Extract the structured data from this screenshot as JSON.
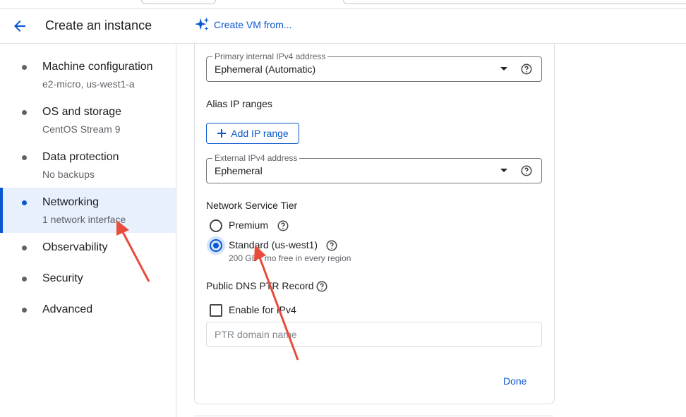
{
  "header": {
    "title": "Create an instance",
    "create_vm_label": "Create VM from..."
  },
  "sidebar": {
    "items": [
      {
        "label": "Machine configuration",
        "sub": "e2-micro, us-west1-a"
      },
      {
        "label": "OS and storage",
        "sub": "CentOS Stream 9"
      },
      {
        "label": "Data protection",
        "sub": "No backups"
      },
      {
        "label": "Networking",
        "sub": "1 network interface"
      },
      {
        "label": "Observability"
      },
      {
        "label": "Security"
      },
      {
        "label": "Advanced"
      }
    ],
    "active_item": "Networking"
  },
  "form": {
    "primary_ip": {
      "label": "Primary internal IPv4 address",
      "value": "Ephemeral (Automatic)"
    },
    "alias_title": "Alias IP ranges",
    "add_ip_range": "Add IP range",
    "external_ip": {
      "label": "External IPv4 address",
      "value": "Ephemeral"
    },
    "network_tier": {
      "title": "Network Service Tier",
      "options": [
        {
          "label": "Premium",
          "selected": false
        },
        {
          "label": "Standard (us-west1)",
          "sub": "200 GB / mo free in every region",
          "selected": true
        }
      ]
    },
    "dns": {
      "title": "Public DNS PTR Record",
      "checkbox_label": "Enable for IPv4",
      "checked": false,
      "ptr_placeholder": "PTR domain name"
    },
    "done": "Done"
  },
  "colors": {
    "accent": "#0b57d0",
    "active_bg": "#e8f0fe",
    "annotation": "#e74c3c"
  }
}
